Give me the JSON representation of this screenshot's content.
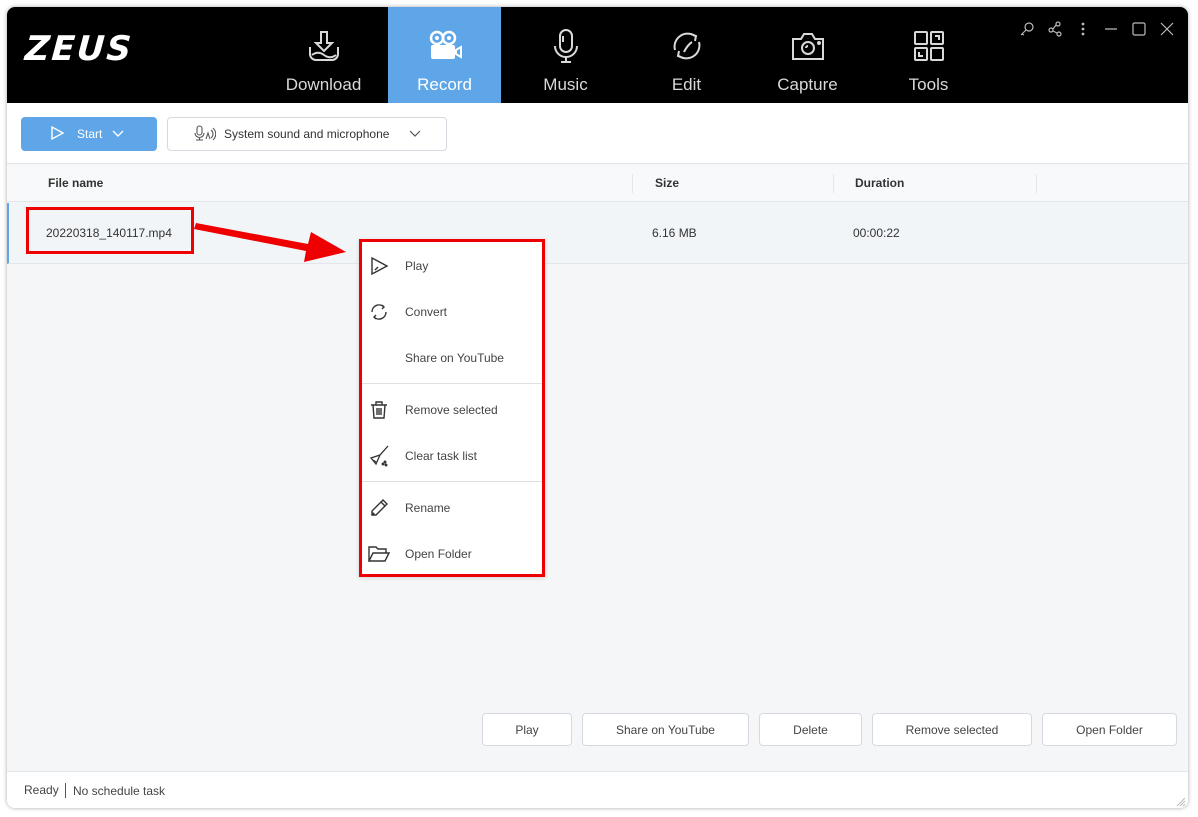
{
  "app": {
    "logo": "ZEUS",
    "accent_color": "#5ea6e8",
    "annotation_color": "#ee0000"
  },
  "nav": {
    "tabs": [
      {
        "label": "Download",
        "icon": "download-icon",
        "active": false
      },
      {
        "label": "Record",
        "icon": "video-camera-icon",
        "active": true
      },
      {
        "label": "Music",
        "icon": "microphone-icon",
        "active": false
      },
      {
        "label": "Edit",
        "icon": "convert-icon",
        "active": false
      },
      {
        "label": "Capture",
        "icon": "camera-icon",
        "active": false
      },
      {
        "label": "Tools",
        "icon": "tools-grid-icon",
        "active": false
      }
    ]
  },
  "window_controls": [
    "key-icon",
    "share-icon",
    "more-icon",
    "minimize-icon",
    "maximize-icon",
    "close-icon"
  ],
  "toolbar": {
    "start_label": "Start",
    "source_label": "System sound and microphone"
  },
  "table": {
    "columns": [
      "File name",
      "Size",
      "Duration"
    ],
    "rows": [
      {
        "file_name": "20220318_140117.mp4",
        "size": "6.16 MB",
        "duration": "00:00:22"
      }
    ]
  },
  "context_menu": {
    "items": [
      {
        "label": "Play",
        "icon": "play-icon"
      },
      {
        "label": "Convert",
        "icon": "convert-icon"
      },
      {
        "label": "Share on YouTube",
        "icon": ""
      },
      {
        "label": "Remove selected",
        "icon": "trash-icon"
      },
      {
        "label": "Clear task list",
        "icon": "broom-icon"
      },
      {
        "label": "Rename",
        "icon": "pencil-icon"
      },
      {
        "label": "Open Folder",
        "icon": "folder-icon"
      }
    ]
  },
  "bottom_buttons": {
    "play": "Play",
    "share": "Share on YouTube",
    "delete": "Delete",
    "remove": "Remove selected",
    "open_folder": "Open Folder"
  },
  "status": {
    "state": "Ready",
    "schedule": "No schedule task"
  }
}
